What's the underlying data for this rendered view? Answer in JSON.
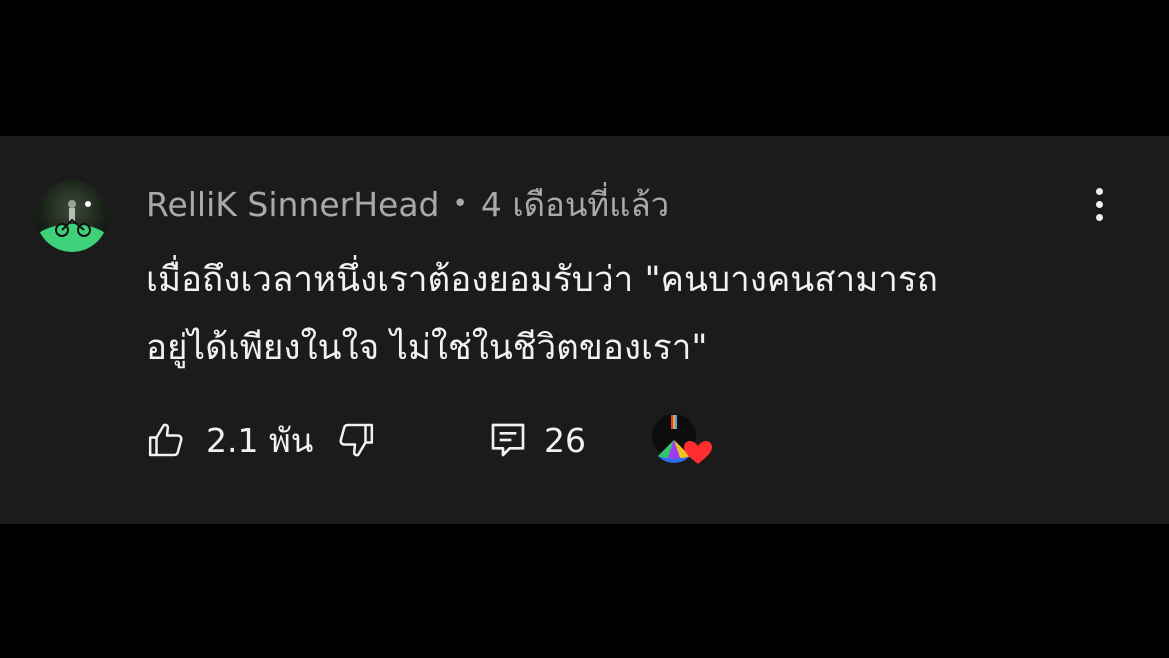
{
  "comment": {
    "author": "RelliK SinnerHead",
    "separator": "•",
    "time": "4 เดือนที่แล้ว",
    "text_lines": [
      "เมื่อถึงเวลาหนึ่งเราต้องยอมรับว่า \"คนบางคนสามารถ",
      "อยู่ได้เพียงในใจ ไม่ใช่ในชีวิตของเรา\""
    ]
  },
  "actions": {
    "likes": "2.1 พัน",
    "replies": "26"
  },
  "icons": {
    "avatar": "profile-photo",
    "menu": "more-vert-icon",
    "like": "thumb-up-icon",
    "dislike": "thumb-down-icon",
    "reply": "comment-icon",
    "heart": "creator-heart-icon"
  },
  "colors": {
    "background": "#000000",
    "card": "#1b1b1b",
    "text": "#f1f1f1",
    "muted": "#a9a9a9",
    "heart": "#ff2d2d"
  }
}
